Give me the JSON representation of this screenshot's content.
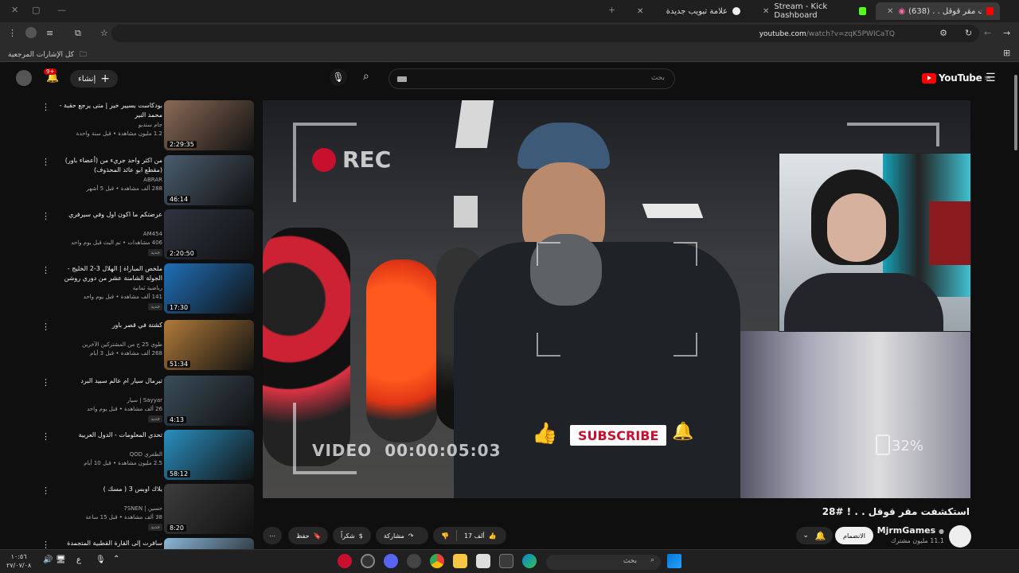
{
  "browser": {
    "tabs": [
      {
        "label": "استكشفت مقر قوقل . . (638)",
        "active": true
      },
      {
        "label": "Stream - Kick Dashboard",
        "active": false
      },
      {
        "label": "علامة تبويب جديدة",
        "active": false
      }
    ],
    "url_domain": "youtube.com",
    "url_path": "/watch?v=zqK5PWICaTQ",
    "bookmarks_label": "كل الإشارات المرجعية"
  },
  "header": {
    "create_label": "إنشاء",
    "search_placeholder": "بحث",
    "notif_count": "9+",
    "logo_text": "YouTube",
    "logo_region": "SA"
  },
  "recommended": [
    {
      "title": "بودكاست بسيير خير | متى يرجع حقبة - محمد النير",
      "channel": "جام ستديو",
      "meta": "1.2 مليون مشاهدة • قبل سنة واحدة",
      "duration": "2:29:35",
      "new": false
    },
    {
      "title": "من اكثر واحد جريء من (أعضاء باور) (مقطع ابو عائد المحذوف)",
      "channel": "ABRAR",
      "meta": "288 ألف مشاهدة • قبل 5 أشهر",
      "duration": "46:14",
      "new": false
    },
    {
      "title": "عرضتكم ما اكون اول وفي سيرفري",
      "channel": "AM454",
      "meta": "406 مشاهدات • تم البث قبل يوم واحد",
      "duration": "2:20:50",
      "new": true
    },
    {
      "title": "ملخص المباراة | الهلال 3-2 الخليج - الجولة الشامنة عشر من دوري روشن",
      "channel": "رياضية ثمانية",
      "meta": "141 ألف مشاهدة • قبل يوم واحد",
      "duration": "17:30",
      "new": true
    },
    {
      "title": "كشتة في قصر باور",
      "channel": "طوي 25 ج من المشتركين الآخرين",
      "meta": "268 ألف مشاهدة • قبل 3 أيام",
      "duration": "51:34",
      "new": false
    },
    {
      "title": "تيرمال سيار ام عالم سبيد البرد",
      "channel": "Sayyar | سيار",
      "meta": "26 ألف مشاهدة • قبل يوم واحد",
      "duration": "4:13",
      "new": true
    },
    {
      "title": "تحدي المعلومات - الدول العربية",
      "channel": "الطفري QOD",
      "meta": "2.5 مليون مشاهدة • قبل 10 أيام",
      "duration": "58:12",
      "new": false
    },
    {
      "title": "بلاك اوبس 3 ( مسك )",
      "channel": "حسين | 7SNEN",
      "meta": "38 ألف مشاهدة • قبل 15 ساعة",
      "duration": "8:20",
      "new": true
    },
    {
      "title": "سافرت إلى القارة القطبية المتجمدة",
      "channel": "",
      "meta": "",
      "duration": "",
      "new": false
    }
  ],
  "video": {
    "overlay_rec": "REC",
    "overlay_video": "VIDEO",
    "overlay_timer": "00:00:05:03",
    "overlay_subscribe": "SUBSCRIBE",
    "overlay_percent": "32%",
    "title": "استكشفت مقر قوقل . . ! #28"
  },
  "channel": {
    "name": "MjrmGames",
    "subs": "11.1 مليون مشترك",
    "join_label": "الانضمام"
  },
  "actions": {
    "likes": "17 ألف",
    "share": "مشاركة",
    "thanks": "شكراً",
    "save": "حفظ"
  },
  "taskbar": {
    "search": "بحث",
    "time": "١٠:٥٦",
    "date": "٢٧/٠٧/٠٨",
    "lang": "ع"
  }
}
